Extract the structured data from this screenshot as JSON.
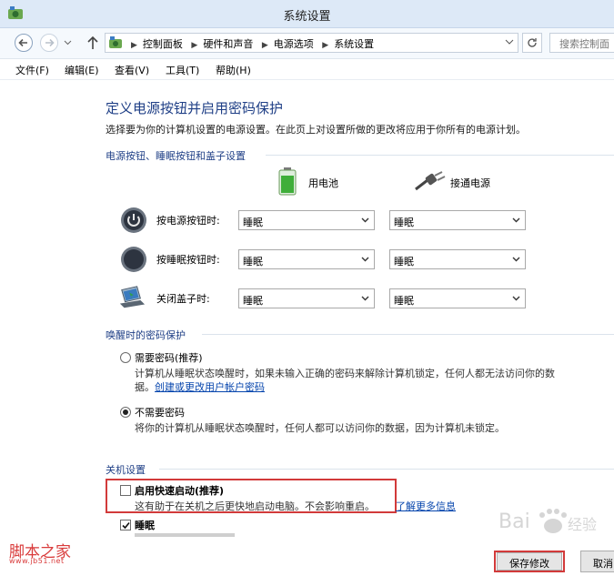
{
  "window": {
    "title": "系统设置"
  },
  "address": {
    "crumbs": [
      "控制面板",
      "硬件和声音",
      "电源选项",
      "系统设置"
    ],
    "search_placeholder": "搜索控制面"
  },
  "menu": [
    "文件(F)",
    "编辑(E)",
    "查看(V)",
    "工具(T)",
    "帮助(H)"
  ],
  "page": {
    "heading": "定义电源按钮并启用密码保护",
    "subtitle": "选择要为你的计算机设置的电源设置。在此页上对设置所做的更改将应用于你所有的电源计划。"
  },
  "power_buttons": {
    "group_title": "电源按钮、睡眠按钮和盖子设置",
    "col_battery": "用电池",
    "col_plugged": "接通电源",
    "rows": [
      {
        "label": "按电源按钮时:",
        "battery": "睡眠",
        "plugged": "睡眠"
      },
      {
        "label": "按睡眠按钮时:",
        "battery": "睡眠",
        "plugged": "睡眠"
      },
      {
        "label": "关闭盖子时:",
        "battery": "睡眠",
        "plugged": "睡眠"
      }
    ]
  },
  "wake_password": {
    "group_title": "唤醒时的密码保护",
    "require": {
      "label": "需要密码(推荐)",
      "desc": "计算机从睡眠状态唤醒时，如果未输入正确的密码来解除计算机锁定，任何人都无法访问你的数",
      "desc2": "据。",
      "link": "创建或更改用户帐户密码",
      "selected": false
    },
    "no_require": {
      "label": "不需要密码",
      "desc": "将你的计算机从睡眠状态唤醒时，任何人都可以访问你的数据，因为计算机未锁定。",
      "selected": true
    }
  },
  "shutdown": {
    "group_title": "关机设置",
    "fast_startup": {
      "label": "启用快速启动(推荐)",
      "desc": "这有助于在关机之后更快地启动电脑。不会影响重启。",
      "link": "了解更多信息",
      "checked": false
    },
    "sleep": {
      "label": "睡眠",
      "checked": true
    }
  },
  "buttons": {
    "save": "保存修改",
    "cancel": "取消"
  },
  "watermarks": {
    "site_name": "脚本之家",
    "site_url": "www.jb51.net"
  },
  "colors": {
    "heading": "#1f3f86",
    "link": "#0645ad",
    "highlight": "#d23a3a"
  }
}
